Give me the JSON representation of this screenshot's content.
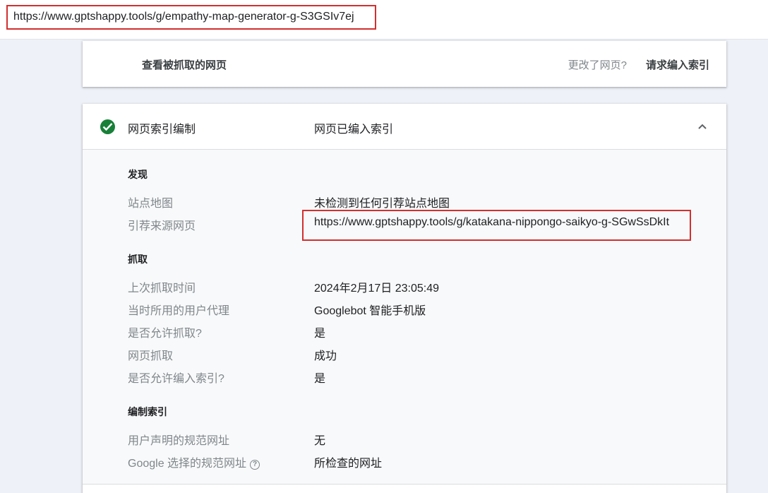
{
  "address_bar": {
    "url": "https://www.gptshappy.tools/g/empathy-map-generator-g-S3GSIv7ej"
  },
  "fetched_card": {
    "view_link": "查看被抓取的网页",
    "changed_text": "更改了网页?",
    "request_label": "请求编入索引"
  },
  "indexing_card": {
    "title": "网页索引编制",
    "status": "网页已编入索引",
    "status_color": "#188038",
    "sections": {
      "discovery": {
        "title": "发现",
        "sitemap_label": "站点地图",
        "sitemap_value": "未检测到任何引荐站点地图",
        "referrer_label": "引荐来源网页",
        "referrer_value": "https://www.gptshappy.tools/g/katakana-nippongo-saikyo-g-SGwSsDkIt"
      },
      "crawl": {
        "title": "抓取",
        "last_crawl_label": "上次抓取时间",
        "last_crawl_value": "2024年2月17日 23:05:49",
        "user_agent_label": "当时所用的用户代理",
        "user_agent_value": "Googlebot 智能手机版",
        "crawl_allowed_label": "是否允许抓取?",
        "crawl_allowed_value": "是",
        "page_fetch_label": "网页抓取",
        "page_fetch_value": "成功",
        "indexing_allowed_label": "是否允许编入索引?",
        "indexing_allowed_value": "是"
      },
      "indexing": {
        "title": "编制索引",
        "user_canonical_label": "用户声明的规范网址",
        "user_canonical_value": "无",
        "google_canonical_label": "Google 选择的规范网址",
        "google_canonical_value": "所检查的网址"
      }
    }
  }
}
